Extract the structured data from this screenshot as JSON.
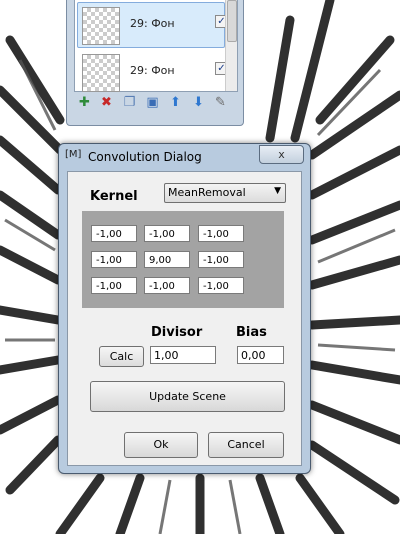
{
  "layers_panel": {
    "rows": [
      {
        "label": "29: Фон",
        "checked": true,
        "selected": true
      },
      {
        "label": "29: Фон",
        "checked": true,
        "selected": false
      }
    ],
    "toolbar_icons": [
      "add-layer-icon",
      "delete-layer-icon",
      "duplicate-layer-icon",
      "merge-down-icon",
      "move-up-icon",
      "move-down-icon",
      "properties-icon"
    ]
  },
  "dialog": {
    "title_icon": "[M]",
    "title": "Convolution Dialog",
    "close_label": "x",
    "kernel_label": "Kernel",
    "kernel_preset": "MeanRemoval",
    "matrix": [
      [
        "-1,00",
        "-1,00",
        "-1,00"
      ],
      [
        "-1,00",
        "9,00",
        "-1,00"
      ],
      [
        "-1,00",
        "-1,00",
        "-1,00"
      ]
    ],
    "divisor_label": "Divisor",
    "bias_label": "Bias",
    "calc_label": "Calc",
    "divisor_value": "1,00",
    "bias_value": "0,00",
    "update_label": "Update Scene",
    "ok_label": "Ok",
    "cancel_label": "Cancel"
  },
  "colors": {
    "matrix_bg": "#a3a3a3",
    "selection": "#d8ebfb",
    "dialog_frame": "#b8cbdf"
  }
}
